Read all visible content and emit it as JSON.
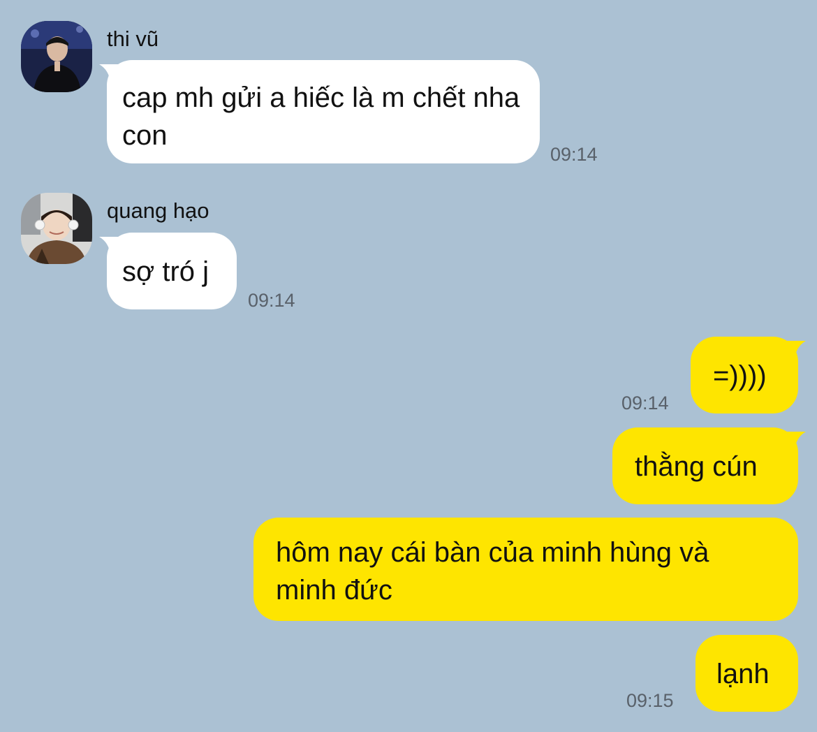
{
  "chat": {
    "messages": [
      {
        "sender": "thi vũ",
        "avatar": "avatar-thi-vu",
        "text": "cap mh gửi a hiếc là m chết nha con",
        "time": "09:14"
      },
      {
        "sender": "quang hạo",
        "avatar": "avatar-quang-hao",
        "text": "sợ tró j",
        "time": "09:14"
      },
      {
        "text": "=))))",
        "time": "09:14"
      },
      {
        "text": "thằng cún"
      },
      {
        "text": "hôm nay cái bàn của minh hùng và minh đức"
      },
      {
        "text": "lạnh",
        "time": "09:15"
      }
    ]
  },
  "colors": {
    "background": "#abc1d3",
    "incoming_bubble": "#ffffff",
    "outgoing_bubble": "#fee500",
    "timestamp": "#59616a"
  }
}
